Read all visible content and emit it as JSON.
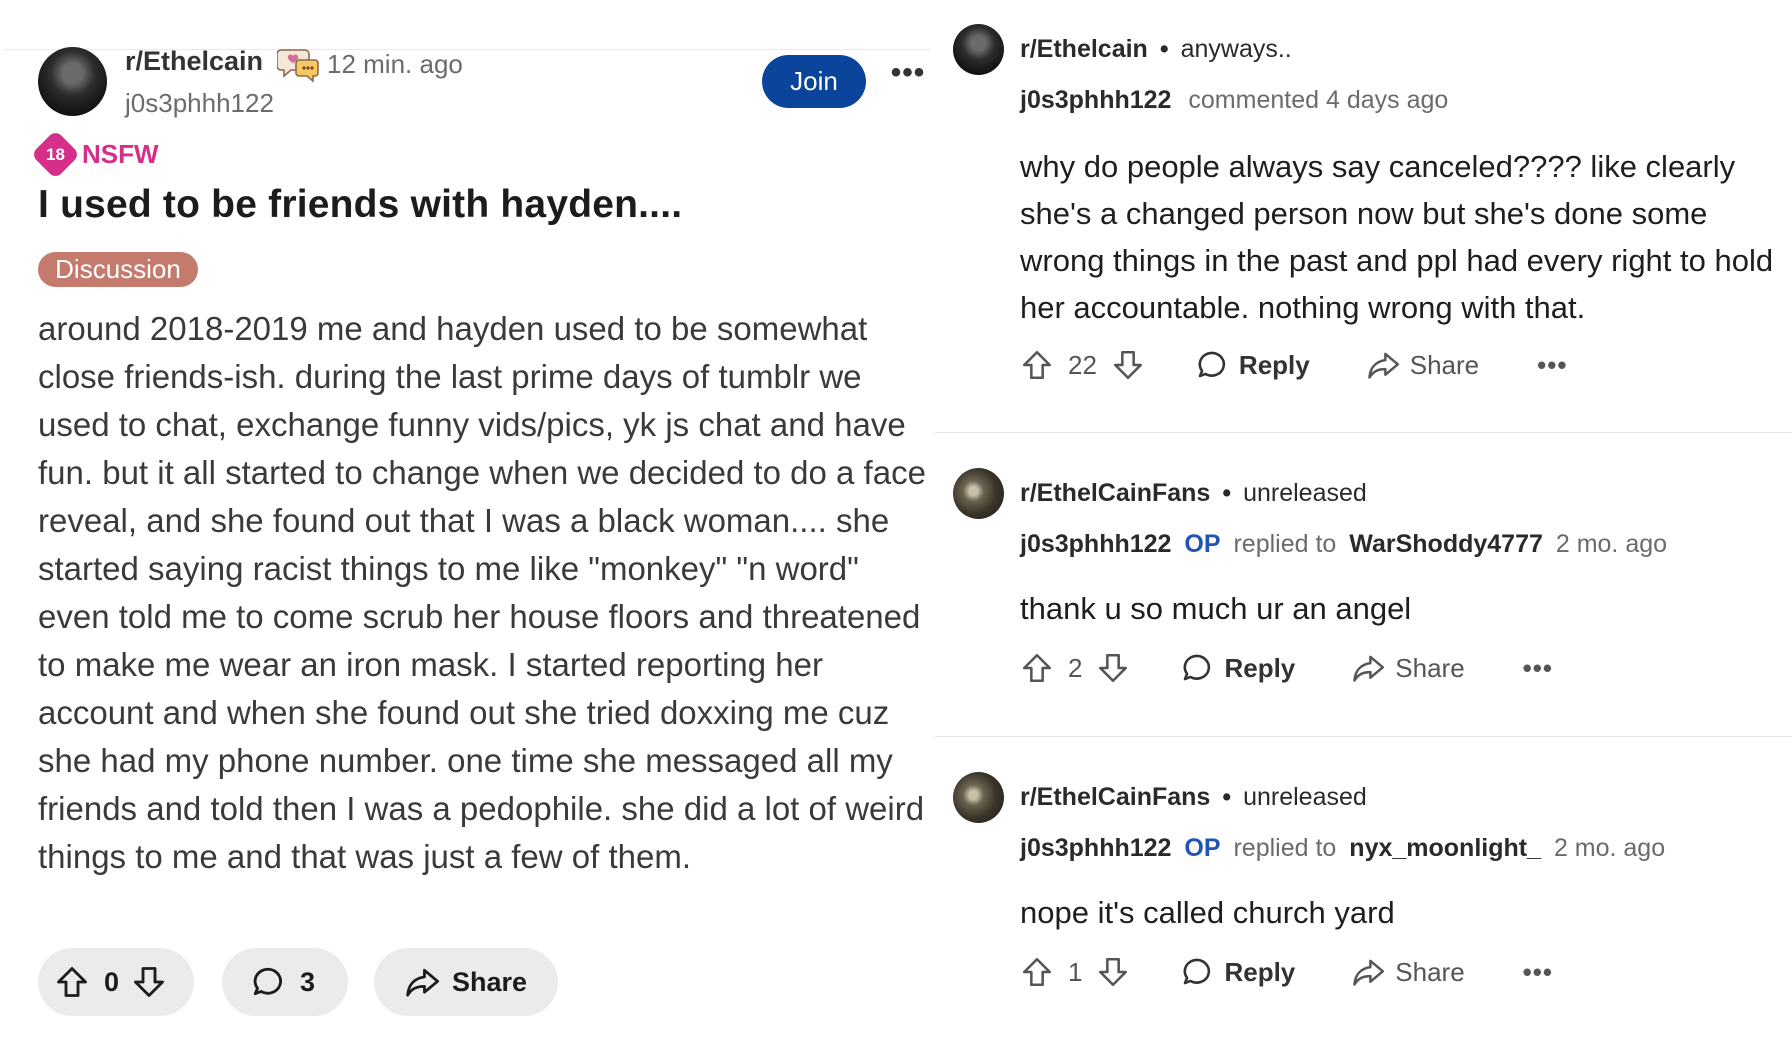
{
  "post": {
    "subreddit": "r/Ethelcain",
    "time": "12 min. ago",
    "author": "j0s3phhh122",
    "join_label": "Join",
    "more_label": "•••",
    "nsfw_badge": "18",
    "nsfw_label": "NSFW",
    "title": "I used to be friends with hayden....",
    "flair": "Discussion",
    "body": "around 2018-2019 me and hayden used to be somewhat close friends-ish. during the last prime days of tumblr we used to chat, exchange funny vids/pics, yk js chat and have fun. but it all started to change when we decided to do a face reveal, and she found out that I was a black woman.... she started saying racist things to me like \"monkey\" \"n word\" even told me to come scrub her house floors and threatened to make me wear an iron mask. I started reporting her account and when she found out she tried doxxing me cuz she had my phone number. one time she messaged all my friends and told then I was a pedophile. she did a lot of weird things to me and that was just a few of them.",
    "votes": "0",
    "comment_count": "3",
    "share_label": "Share"
  },
  "comments": [
    {
      "subreddit": "r/Ethelcain",
      "post_title": "anyways..",
      "author": "j0s3phhh122",
      "meta": "commented 4 days ago",
      "text": "why do people always say canceled???? like clearly she's a changed person now but she's done some wrong things in the past and ppl had every right to hold her accountable. nothing wrong with that.",
      "votes": "22",
      "reply_label": "Reply",
      "share_label": "Share",
      "more_label": "•••"
    },
    {
      "subreddit": "r/EthelCainFans",
      "post_title": "unreleased",
      "author": "j0s3phhh122",
      "op_label": "OP",
      "replied_to_label": "replied to",
      "replied_to": "WarShoddy4777",
      "time": "2 mo. ago",
      "text": "thank u so much ur an angel",
      "votes": "2",
      "reply_label": "Reply",
      "share_label": "Share",
      "more_label": "•••"
    },
    {
      "subreddit": "r/EthelCainFans",
      "post_title": "unreleased",
      "author": "j0s3phhh122",
      "op_label": "OP",
      "replied_to_label": "replied to",
      "replied_to": "nyx_moonlight_",
      "time": "2 mo. ago",
      "text": "nope it's called church yard",
      "votes": "1",
      "reply_label": "Reply",
      "share_label": "Share",
      "more_label": "•••"
    }
  ],
  "separator_dot": "•"
}
